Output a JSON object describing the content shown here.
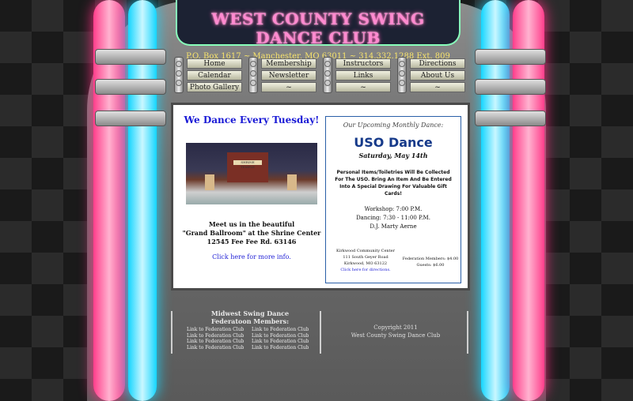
{
  "site": {
    "title": "WEST COUNTY SWING DANCE CLUB",
    "address": "P.O. Box 1617 ~ Manchester, MO 63011 ~ 314.332.1288 Ext. 809"
  },
  "nav": {
    "groups": [
      {
        "items": [
          "Home",
          "Calendar",
          "Photo Gallery"
        ]
      },
      {
        "items": [
          "Membership",
          "Newsletter",
          "~"
        ]
      },
      {
        "items": [
          "Instructors",
          "Links",
          "~"
        ]
      },
      {
        "items": [
          "Directions",
          "About Us",
          "~"
        ]
      }
    ]
  },
  "left": {
    "tagline": "We Dance Every Tuesday!",
    "photo_sign": "SHRINE TEMPLE",
    "meet_line1": "Meet us in the beautiful",
    "meet_line2": "\"Grand Ballroom\" at the Shrine Center",
    "meet_line3": "12545 Fee Fee Rd. 63146",
    "more_info": "Click here for more info."
  },
  "right": {
    "upcoming": "Our Upcoming Monthly Dance:",
    "event_title": "USO Dance",
    "event_date": "Saturday, May 14th",
    "event_note": "Personal Items/Toiletries Will Be Collected For The USO. Bring An Item And Be Entered Into A Special Drawing For Valuable Gift Cards!",
    "workshop": "Workshop: 7:00 P.M.",
    "dancing": "Dancing: 7:30 - 11:00 P.M.",
    "dj": "D.J. Marty Aerne",
    "venue_name": "Kirkwood Community Center",
    "venue_street": "111 South Geyer Road",
    "venue_city": "Kirkwood, MO 63122",
    "venue_directions": "Click here for directions.",
    "price_members": "Federation Members: $4.00",
    "price_guests": "Guests: $6.00"
  },
  "footer": {
    "fed_title_line1": "Midwest Swing Dance",
    "fed_title_line2": "Federatoon Members:",
    "col1": [
      "Link to Federation Club",
      "Link to Federation Club",
      "Link to Federation Club",
      "Link to Federation Club"
    ],
    "col2": [
      "Link to Federation Club",
      "Link to Federation Club",
      "Link to Federation Club",
      "Link to Federation Club"
    ],
    "copyright_line1": "Copyright 2011",
    "copyright_line2": "West County Swing Dance Club"
  }
}
